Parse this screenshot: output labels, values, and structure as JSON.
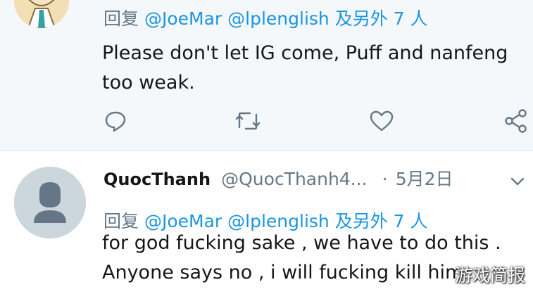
{
  "tweet_1": {
    "reply_prefix": "回复",
    "mention_1": "@JoeMar",
    "mention_2": "@lplenglish",
    "reply_suffix": "及另外 7 人",
    "body_line_1": "Please don't let IG come, Puff and nanfeng",
    "body_line_2": "too weak.",
    "actions": [
      "reply-icon",
      "retweet-icon",
      "like-icon",
      "share-icon"
    ]
  },
  "tweet_2": {
    "display_name": "QuocThanh",
    "handle": "@QuocThanh4...",
    "dot": "·",
    "date": "5月2日",
    "reply_prefix": "回复",
    "mention_1": "@JoeMar",
    "mention_2": "@lplenglish",
    "reply_suffix": "及另外 7 人",
    "body_line_1": "for god fucking sake , we have to do this .",
    "body_line_2": "Anyone says no , i will fucking kill him"
  },
  "watermark": "游戏简报",
  "colors": {
    "link": "#1b95e0",
    "secondary_text": "#657786",
    "icon": "#657786",
    "divider": "#e1e8ed"
  }
}
